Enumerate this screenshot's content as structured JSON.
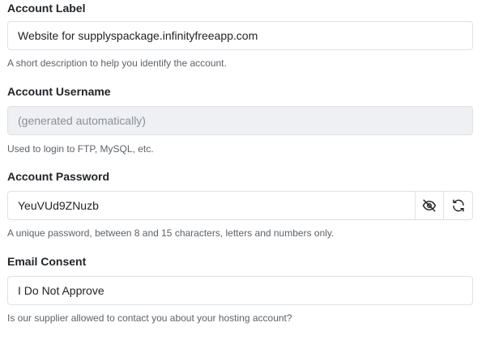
{
  "fields": {
    "label": {
      "label": "Account Label",
      "value": "Website for supplyspackage.infinityfreeapp.com",
      "help": "A short description to help you identify the account."
    },
    "username": {
      "label": "Account Username",
      "placeholder": "(generated automatically)",
      "help": "Used to login to FTP, MySQL, etc."
    },
    "password": {
      "label": "Account Password",
      "value": "YeuVUd9ZNuzb",
      "help": "A unique password, between 8 and 15 characters, letters and numbers only.",
      "toggle_icon": "eye-slash-icon",
      "regenerate_icon": "refresh-icon"
    },
    "consent": {
      "label": "Email Consent",
      "value": "I Do Not Approve",
      "help": "Is our supplier allowed to contact you about your hosting account?"
    }
  }
}
